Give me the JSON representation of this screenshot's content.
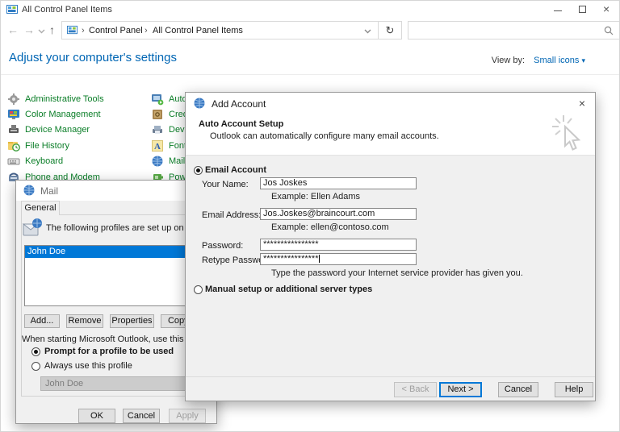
{
  "window": {
    "title": "All Control Panel Items",
    "breadcrumb": {
      "items": [
        "Control Panel",
        "All Control Panel Items"
      ],
      "separator": "›"
    },
    "search_value": "",
    "heading": "Adjust your computer's settings",
    "view_by": {
      "label": "View by:",
      "value": "Small icons",
      "dropdown": "▾"
    }
  },
  "icons": {
    "back": "←",
    "forward": "→",
    "up": "↑",
    "refresh": "↻",
    "close": "×"
  },
  "control_panel": {
    "col1": [
      "Administrative Tools",
      "Color Management",
      "Device Manager",
      "File History",
      "Keyboard",
      "Phone and Modem"
    ],
    "col2": [
      "AutoPlay",
      "Credential Manager",
      "Devices and Printers",
      "Fonts",
      "Mail",
      "Power Options"
    ]
  },
  "mail_dialog": {
    "title": "Mail",
    "tab": "General",
    "description": "The following profiles are set up on this computer:",
    "profiles": [
      "John Doe"
    ],
    "buttons": {
      "add": "Add...",
      "remove": "Remove",
      "properties": "Properties",
      "copy": "Copy..."
    },
    "startup_label": "When starting Microsoft Outlook, use this profile:",
    "radio_prompt": "Prompt for a profile to be used",
    "radio_always": "Always use this profile",
    "dropdown_value": "John Doe",
    "ok": "OK",
    "cancel": "Cancel",
    "apply": "Apply"
  },
  "add_account": {
    "title": "Add Account",
    "header": {
      "title": "Auto Account Setup",
      "subtitle": "Outlook can automatically configure many email accounts."
    },
    "radio_email": "Email Account",
    "fields": {
      "name": {
        "label": "Your Name:",
        "value": "Jos Joskes",
        "hint": "Example: Ellen Adams"
      },
      "email": {
        "label": "Email Address:",
        "value": "Jos.Joskes@braincourt.com",
        "hint": "Example: ellen@contoso.com"
      },
      "password": {
        "label": "Password:",
        "value": "****************"
      },
      "retype": {
        "label": "Retype Password:",
        "value": "****************"
      }
    },
    "password_note": "Type the password your Internet service provider has given you.",
    "radio_manual": "Manual setup or additional server types",
    "buttons": {
      "back": "< Back",
      "next": "Next >",
      "cancel": "Cancel",
      "help": "Help"
    }
  },
  "colors": {
    "accent_blue": "#0078d7",
    "link_blue": "#0066b4",
    "item_green": "#0b7e28",
    "selection": "#0078d7",
    "dialog_bg": "#f0f0f0"
  }
}
